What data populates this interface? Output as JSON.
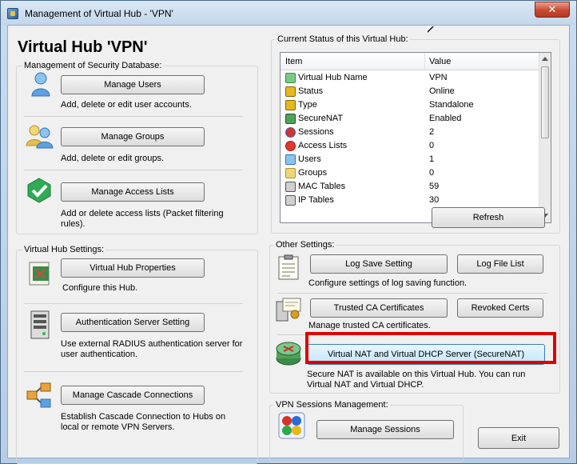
{
  "window": {
    "title": "Management of Virtual Hub - 'VPN'",
    "close_label": "✕"
  },
  "hub_title": "Virtual Hub 'VPN'",
  "security_db": {
    "label": "Management of Security Database:",
    "manage_users": {
      "button": "Manage Users",
      "desc": "Add, delete or edit user accounts."
    },
    "manage_groups": {
      "button": "Manage Groups",
      "desc": "Add, delete or edit groups."
    },
    "manage_access_lists": {
      "button": "Manage Access Lists",
      "desc": "Add or delete access lists (Packet filtering rules)."
    }
  },
  "hub_settings": {
    "label": "Virtual Hub Settings:",
    "properties": {
      "button": "Virtual Hub Properties",
      "desc": "Configure this Hub."
    },
    "auth_server": {
      "button": "Authentication Server Setting",
      "desc": "Use external RADIUS authentication server for user authentication."
    },
    "cascade": {
      "button": "Manage Cascade Connections",
      "desc": "Establish Cascade Connection to Hubs on local or remote VPN Servers."
    }
  },
  "status": {
    "label": "Current Status of this Virtual Hub:",
    "columns": [
      "Item",
      "Value"
    ],
    "rows": [
      {
        "item": "Virtual Hub Name",
        "value": "VPN",
        "icon": "hub-icon"
      },
      {
        "item": "Status",
        "value": "Online",
        "icon": "status-icon"
      },
      {
        "item": "Type",
        "value": "Standalone",
        "icon": "type-icon"
      },
      {
        "item": "SecureNAT",
        "value": "Enabled",
        "icon": "securenat-icon"
      },
      {
        "item": "Sessions",
        "value": "2",
        "icon": "sessions-icon"
      },
      {
        "item": "Access Lists",
        "value": "0",
        "icon": "access-lists-icon"
      },
      {
        "item": "Users",
        "value": "1",
        "icon": "user-icon"
      },
      {
        "item": "Groups",
        "value": "0",
        "icon": "groups-icon"
      },
      {
        "item": "MAC Tables",
        "value": "59",
        "icon": "mac-tables-icon"
      },
      {
        "item": "IP Tables",
        "value": "30",
        "icon": "ip-tables-icon"
      }
    ],
    "refresh_button": "Refresh"
  },
  "other_settings": {
    "label": "Other Settings:",
    "log_save_button": "Log Save Setting",
    "log_file_list_button": "Log File List",
    "log_desc": "Configure settings of log saving function.",
    "trusted_ca_button": "Trusted CA Certificates",
    "revoked_certs_button": "Revoked Certs",
    "ca_desc": "Manage trusted CA certificates.",
    "securenat_button": "Virtual NAT and Virtual DHCP Server (SecureNAT)",
    "securenat_desc": "Secure NAT is available on this Virtual Hub. You can run Virtual NAT and Virtual DHCP."
  },
  "sessions": {
    "label": "VPN Sessions Management:",
    "manage_sessions_button": "Manage Sessions"
  },
  "exit_button": "Exit",
  "colors": {
    "highlight": "#e00000",
    "close": "#c84a32"
  }
}
